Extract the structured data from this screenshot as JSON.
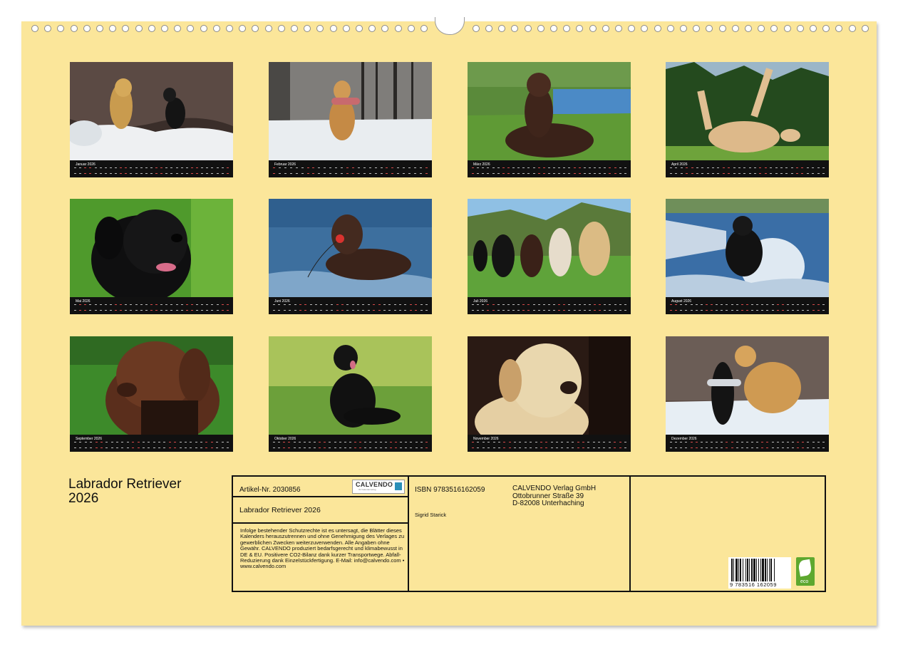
{
  "calendar_title_line1": "Labrador Retriever",
  "calendar_title_line2": "2026",
  "months": [
    {
      "label": "Januar 2026",
      "photo": "Yellow and black labrador running in snow",
      "start": 3,
      "days": 31
    },
    {
      "label": "Februar 2026",
      "photo": "Yellow labrador carrying toy in snow",
      "start": 6,
      "days": 28
    },
    {
      "label": "März 2026",
      "photo": "Chocolate labrador lying on grass by lake",
      "start": 6,
      "days": 31
    },
    {
      "label": "April 2026",
      "photo": "Yellow labrador rolling on its back in grass",
      "start": 2,
      "days": 30
    },
    {
      "label": "Mai 2026",
      "photo": "Black labrador portrait on green background",
      "start": 4,
      "days": 31
    },
    {
      "label": "Juni 2026",
      "photo": "Chocolate labrador swimming with red ball",
      "start": 0,
      "days": 30
    },
    {
      "label": "Juli 2026",
      "photo": "Pack of labradors running on grass",
      "start": 2,
      "days": 31
    },
    {
      "label": "August 2026",
      "photo": "Black labrador splashing through water",
      "start": 5,
      "days": 31
    },
    {
      "label": "September 2026",
      "photo": "Chocolate labrador portrait",
      "start": 1,
      "days": 30
    },
    {
      "label": "Oktober 2026",
      "photo": "Black labrador puppy sitting in grass",
      "start": 3,
      "days": 31
    },
    {
      "label": "November 2026",
      "photo": "Yellow labrador portrait on dark background",
      "start": 6,
      "days": 30
    },
    {
      "label": "Dezember 2026",
      "photo": "Black and yellow labrador playing in snow",
      "start": 1,
      "days": 31
    }
  ],
  "imprint": {
    "article_no": "Artikel-Nr. 2030856",
    "logo_name": "CALVENDO",
    "logo_sub": "Ihr Kalenderverlag",
    "title": "Labrador Retriever 2026",
    "legal_text": "Infolge bestehender Schutzrechte ist es untersagt, die Blätter dieses Kalenders herauszutrennen und ohne Genehmigung des Verlages zu gewerblichen Zwecken weiterzuverwenden. Alle Angaben ohne Gewähr. CALVENDO produziert bedarfsgerecht und klimabewusst in DE & EU. Positivere CO2-Bilanz dank kurzer Transportwege. Abfall-Reduzierung dank Einzelstückfertigung. E-Mail: info@calvendo.com • www.calvendo.com",
    "isbn": "ISBN 9783516162059",
    "author": "Sigrid Starick",
    "publisher_line1": "CALVENDO Verlag GmbH",
    "publisher_line2": "Ottobrunner Straße 39",
    "publisher_line3": "D-82008 Unterhaching",
    "barcode_number": "9 783516 162059",
    "eco_label": "eco"
  }
}
